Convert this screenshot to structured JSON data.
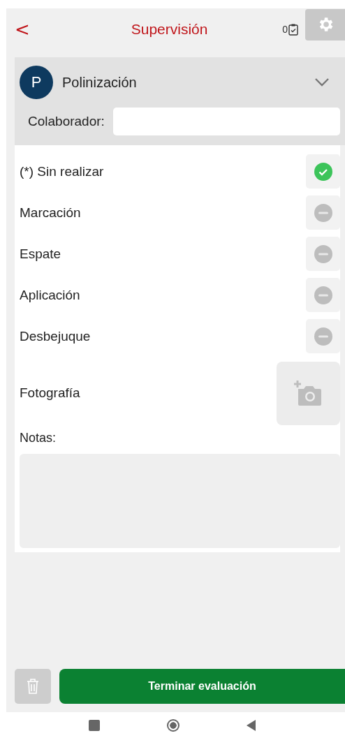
{
  "header": {
    "back": "<",
    "title": "Supervisión",
    "count": "0"
  },
  "section": {
    "avatar": "P",
    "title": "Polinización",
    "expanded": false,
    "collaborator_label": "Colaborador:"
  },
  "items": [
    {
      "label": "(*) Sin realizar",
      "checked": true
    },
    {
      "label": "Marcación",
      "checked": false
    },
    {
      "label": "Espate",
      "checked": false
    },
    {
      "label": "Aplicación",
      "checked": false
    },
    {
      "label": "Desbejuque",
      "checked": false
    }
  ],
  "photo_label": "Fotografía",
  "notes_label": "Notas:",
  "finish_button": "Terminar evaluación"
}
